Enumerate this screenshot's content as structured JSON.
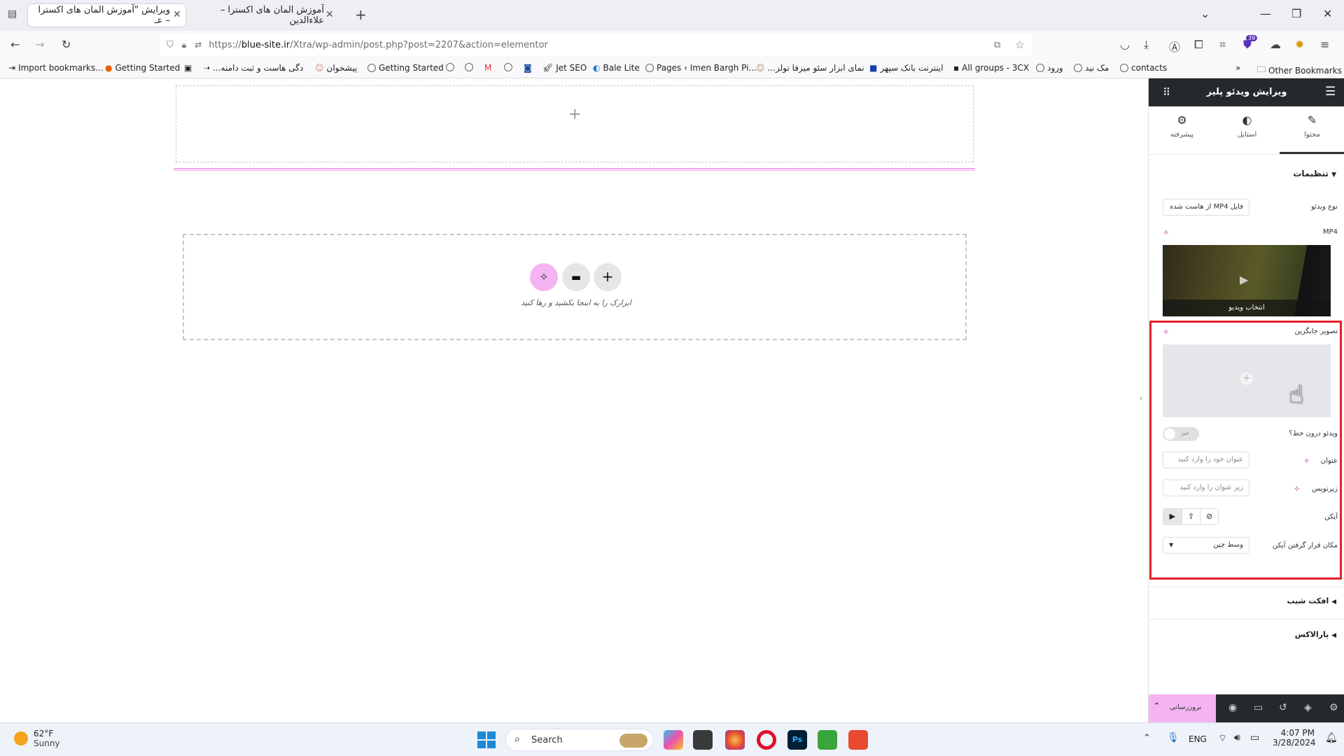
{
  "browser": {
    "tabs": [
      {
        "title": "ویرایش \"آموزش المان های اکسترا – عـ"
      },
      {
        "title": "آموزش المان های اکسترا – علاءالدین"
      }
    ],
    "url": {
      "prefix": "https://",
      "domain": "blue-site.ir",
      "path": "/Xtra/wp-admin/post.php?post=2207&action=elementor"
    },
    "extension_badge": "39"
  },
  "bookmarks": [
    "Import bookmarks...",
    "Getting Started",
    "...دگی هاست و ثبت دامنه",
    "پیشخوان",
    "Getting Started",
    "Jet SEO",
    "Bale Lite",
    "Pages ‹ Imen Bargh Pi...",
    "...نمای ابزار سئو میزفا تولز",
    "اینترنت بانک سپهر",
    "All groups - 3CX",
    "ورود",
    "مک نید",
    "contacts",
    "Other Bookmarks"
  ],
  "canvas": {
    "drop_hint": "ابزارک را به اینجا بکشید و رها کنید"
  },
  "panel": {
    "header_title": "ویرایش ویدئو پلیر",
    "tabs": [
      {
        "label": "محتوا",
        "icon": "pencil-icon"
      },
      {
        "label": "استایل",
        "icon": "contrast-icon"
      },
      {
        "label": "پیشرفته",
        "icon": "gear-icon"
      }
    ],
    "section_settings": "تنظیمات",
    "video_type_label": "نوع ویدئو",
    "video_type_value": "فایل MP4 از هاست شده",
    "mp4_label": "MP4",
    "choose_video": "انتخاب ویدیو",
    "placeholder_image_label": "تصویر جایگزین",
    "inline_video_label": "ویدئو درون خط؟",
    "inline_video_toggle": "خیر",
    "title_label": "عنوان",
    "title_placeholder": "عنوان خود را وارد کنید",
    "subtitle_label": "زیرنویس",
    "subtitle_placeholder": "زیر عنوان را وارد کنید",
    "icon_label": "آیکن",
    "icon_position_label": "مکان قرار گرفتن آیکن",
    "icon_position_value": "وسط چین",
    "section_tilt": "افکت شیب",
    "section_parallax": "پارالاکس",
    "update_button": "بروزرسانی"
  },
  "taskbar": {
    "weather_temp": "62°F",
    "weather_desc": "Sunny",
    "search_placeholder": "Search",
    "lang": "ENG",
    "time": "4:07 PM",
    "date": "3/28/2024"
  },
  "colors": {
    "highlight_border": "#e3202a",
    "panel_header": "#26292c",
    "ai_pink": "#f4b4f1"
  }
}
